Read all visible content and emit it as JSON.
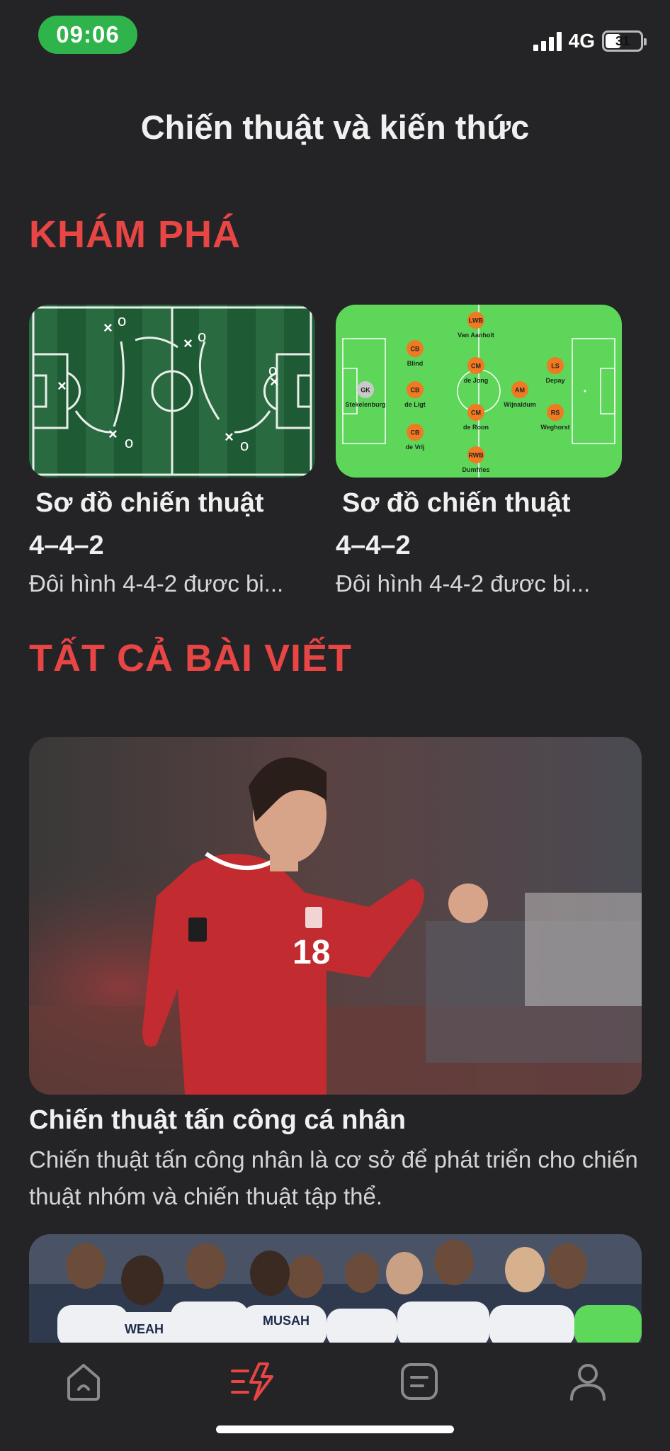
{
  "status_bar": {
    "time": "09:06",
    "network": "4G",
    "battery": "31"
  },
  "page_title": "Chiến thuật và kiến thức",
  "explore": {
    "heading": "KHÁM PHÁ",
    "cards": [
      {
        "title_line1": "Sơ đồ chiến thuật",
        "title_line2": "4–4–2",
        "description": "Đôi hình 4-4-2 đươc bi..."
      },
      {
        "title_line1": "Sơ đồ chiến thuật",
        "title_line2": "4–4–2",
        "description": "Đôi hình 4-4-2 đươc bi..."
      }
    ],
    "formation": {
      "players": [
        {
          "pos": "LWB",
          "name": "Van Aanholt"
        },
        {
          "pos": "CB",
          "name": "Blind"
        },
        {
          "pos": "GK",
          "name": "Stekelenburg"
        },
        {
          "pos": "CB",
          "name": "de Ligt"
        },
        {
          "pos": "CB",
          "name": "de Vrij"
        },
        {
          "pos": "CM",
          "name": "de Jong"
        },
        {
          "pos": "CM",
          "name": "de Roon"
        },
        {
          "pos": "AM",
          "name": "Wijnaldum"
        },
        {
          "pos": "LS",
          "name": "Depay"
        },
        {
          "pos": "RS",
          "name": "Weghorst"
        },
        {
          "pos": "RWB",
          "name": "Dumfries"
        }
      ]
    }
  },
  "articles": {
    "heading": "TẤT CẢ BÀI VIẾT",
    "items": [
      {
        "shirt_number": "18",
        "title": "Chiến thuật tấn công cá nhân",
        "description": "Chiến thuật tấn công nhân là cơ sở để phát triển cho chiến thuật nhóm và chiến thuật tập thể."
      },
      {
        "shirt_name": "WEAH",
        "shirt_name_2": "MUSAH"
      }
    ]
  },
  "tabbar": {
    "active_color": "#e84545",
    "inactive_color": "#8a8a8e",
    "tabs": [
      "home-icon",
      "tactics-icon",
      "news-icon",
      "profile-icon"
    ]
  }
}
